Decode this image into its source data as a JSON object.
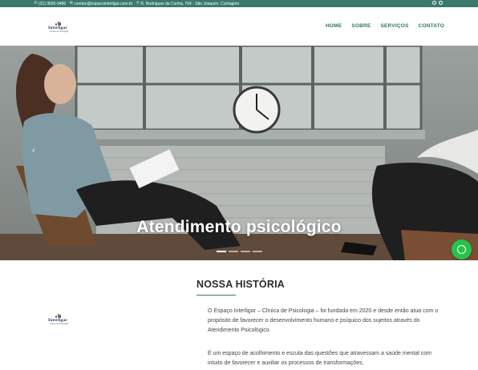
{
  "topbar": {
    "phone": "(31) 3665-9486",
    "email": "contato@espacointerligar.com.br",
    "address": "R. Rodrigues da Cunha, 764 - São Joaquim, Contagem",
    "social_icons": [
      "instagram-icon",
      "whatsapp-icon"
    ]
  },
  "header": {
    "logo_text": "Interligar",
    "logo_tagline": "Clínica de Psicologia",
    "nav": [
      "HOME",
      "SOBRE",
      "SERVIÇOS",
      "CONTATO"
    ]
  },
  "hero": {
    "title": "Atendimento psicológico",
    "slide_count": 4,
    "active_slide": 1
  },
  "story": {
    "title": "NOSSA HISTÓRIA",
    "paragraphs": [
      "O Espaço Interligar – Clínica de Psicologia – foi fundada em 2020 e desde então atua com o propósito de favorecer o desenvolvimento humano e psíquico dos sujeitos através do Atendimento Psicológico.",
      "É um espaço de acolhimento e escuta das questões que atravessam a saúde mental com intuito de favorecer e auxiliar os processos de transformações."
    ]
  },
  "colors": {
    "brand_green": "#3a7a6b",
    "whatsapp_green": "#27c24b",
    "logo_navy": "#1c3a5e"
  }
}
